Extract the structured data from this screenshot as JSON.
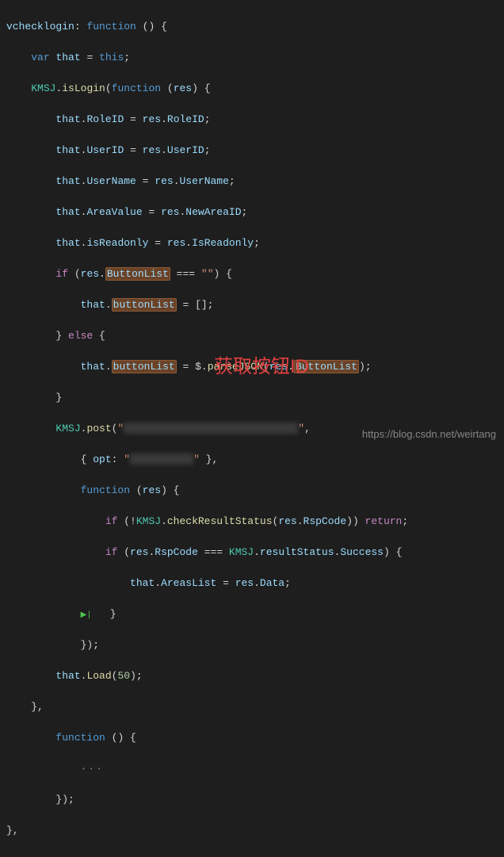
{
  "code": {
    "l1_a": "vchecklogin",
    "l1_b": "function",
    "l2_a": "var",
    "l2_b": "that",
    "l2_c": "this",
    "l3_a": "KMSJ",
    "l3_b": "isLogin",
    "l3_c": "function",
    "l3_d": "res",
    "l4_a": "that",
    "l4_b": "RoleID",
    "l4_c": "res",
    "l4_d": "RoleID",
    "l5_a": "that",
    "l5_b": "UserID",
    "l5_c": "res",
    "l5_d": "UserID",
    "l6_a": "that",
    "l6_b": "UserName",
    "l6_c": "res",
    "l6_d": "UserName",
    "l7_a": "that",
    "l7_b": "AreaValue",
    "l7_c": "res",
    "l7_d": "NewAreaID",
    "l8_a": "that",
    "l8_b": "isReadonly",
    "l8_c": "res",
    "l8_d": "IsReadonly",
    "l9_a": "if",
    "l9_b": "res",
    "l9_c": "ButtonList",
    "l9_d": "\"\"",
    "l10_a": "that",
    "l10_b": "buttonList",
    "l11_a": "else",
    "l12_a": "that",
    "l12_b": "buttonList",
    "l12_c": "parseJSON",
    "l12_d": "res",
    "l12_e": "ButtonList",
    "l14_a": "KMSJ",
    "l14_b": "post",
    "l15_a": "opt",
    "l16_a": "function",
    "l16_b": "res",
    "l17_a": "if",
    "l17_b": "KMSJ",
    "l17_c": "checkResultStatus",
    "l17_d": "res",
    "l17_e": "RspCode",
    "l17_f": "return",
    "l18_a": "if",
    "l18_b": "res",
    "l18_c": "RspCode",
    "l18_d": "KMSJ",
    "l18_e": "resultStatus",
    "l18_f": "Success",
    "l19_a": "that",
    "l19_b": "AreasList",
    "l19_c": "res",
    "l19_d": "Data",
    "l22_a": "that",
    "l22_b": "Load",
    "l22_c": "50",
    "l24_a": "function"
  },
  "annotation_text": "获取按钮ID",
  "watermark_text": "https://blog.csdn.net/weirtang"
}
